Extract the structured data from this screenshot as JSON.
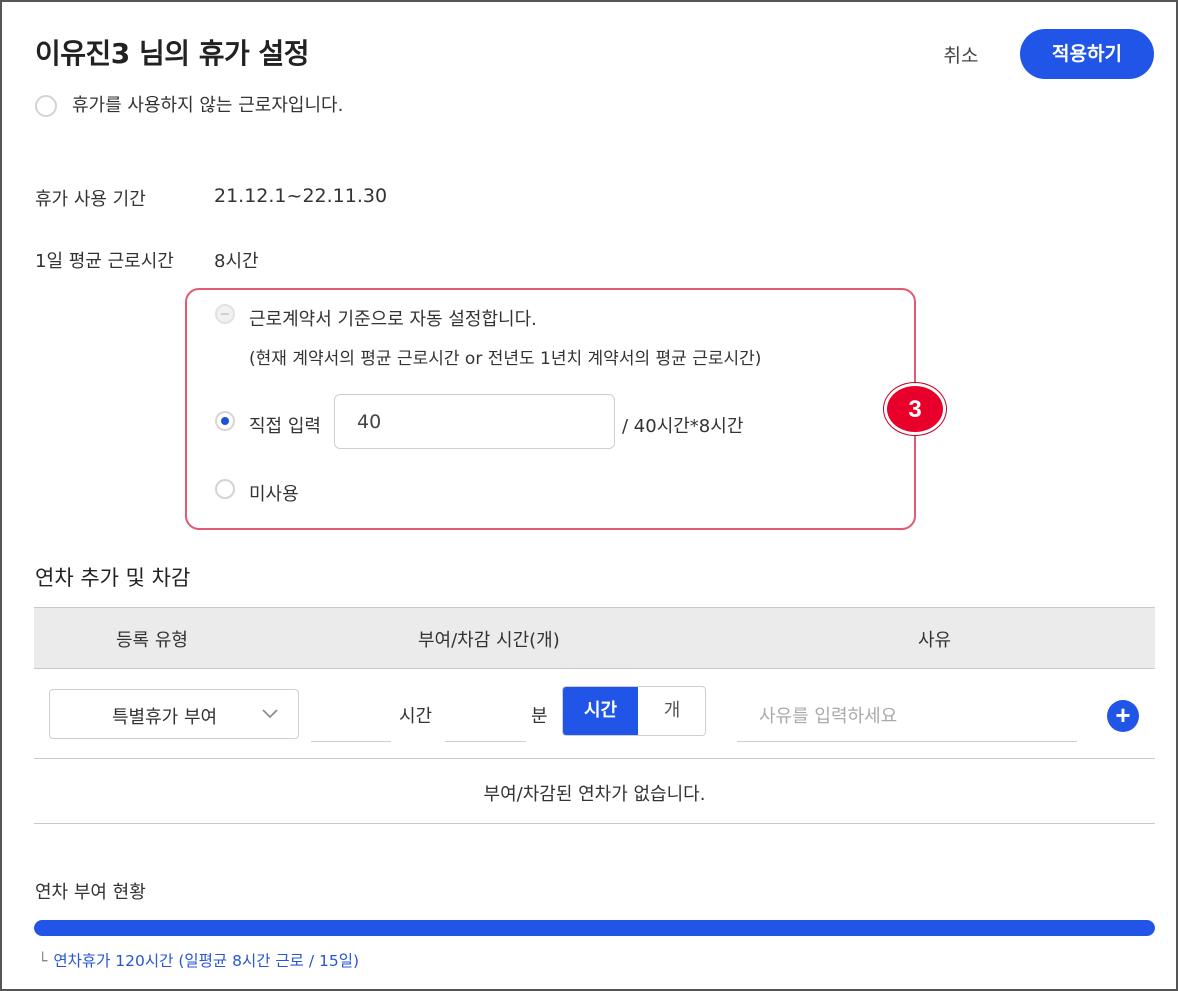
{
  "header": {
    "title": "이유진3 님의 휴가 설정",
    "cancel_label": "취소",
    "apply_label": "적용하기"
  },
  "no_vacation_option": {
    "label": "휴가를 사용하지 않는 근로자입니다.",
    "checked": false
  },
  "info": {
    "period_label": "휴가 사용 기간",
    "period_value": "21.12.1~22.11.30",
    "avg_hours_label": "1일 평균 근로시간",
    "avg_hours_value": "8시간"
  },
  "hours_setting": {
    "auto_option": {
      "label": "근로계약서 기준으로 자동 설정합니다.",
      "note": "(현재 계약서의 평균 근로시간 or 전년도 1년치 계약서의 평균 근로시간)",
      "state": "disabled"
    },
    "direct_option": {
      "label": "직접 입력",
      "input_value": "40",
      "suffix": "/ 40시간*8시간",
      "state": "checked"
    },
    "none_option": {
      "label": "미사용",
      "state": "unchecked"
    },
    "step_badge": "3"
  },
  "adjustment": {
    "section_title": "연차 추가 및 차감",
    "columns": [
      "등록 유형",
      "부여/차감 시간(개)",
      "사유"
    ],
    "type_select_value": "특별휴가 부여",
    "hour_unit": "시간",
    "minute_unit": "분",
    "toggle_hour_label": "시간",
    "toggle_count_label": "개",
    "reason_placeholder": "사유를 입력하세요",
    "empty_message": "부여/차감된 연차가 없습니다."
  },
  "grant_status": {
    "title": "연차 부여 현황",
    "progress_fraction": 1.0,
    "note_prefix": "└",
    "note": "연차휴가 120시간 (일평균 8시간 근로 / 15일)"
  },
  "colors": {
    "accent": "#2055e8",
    "highlight_border": "#e05a72",
    "badge": "#e8002a"
  }
}
